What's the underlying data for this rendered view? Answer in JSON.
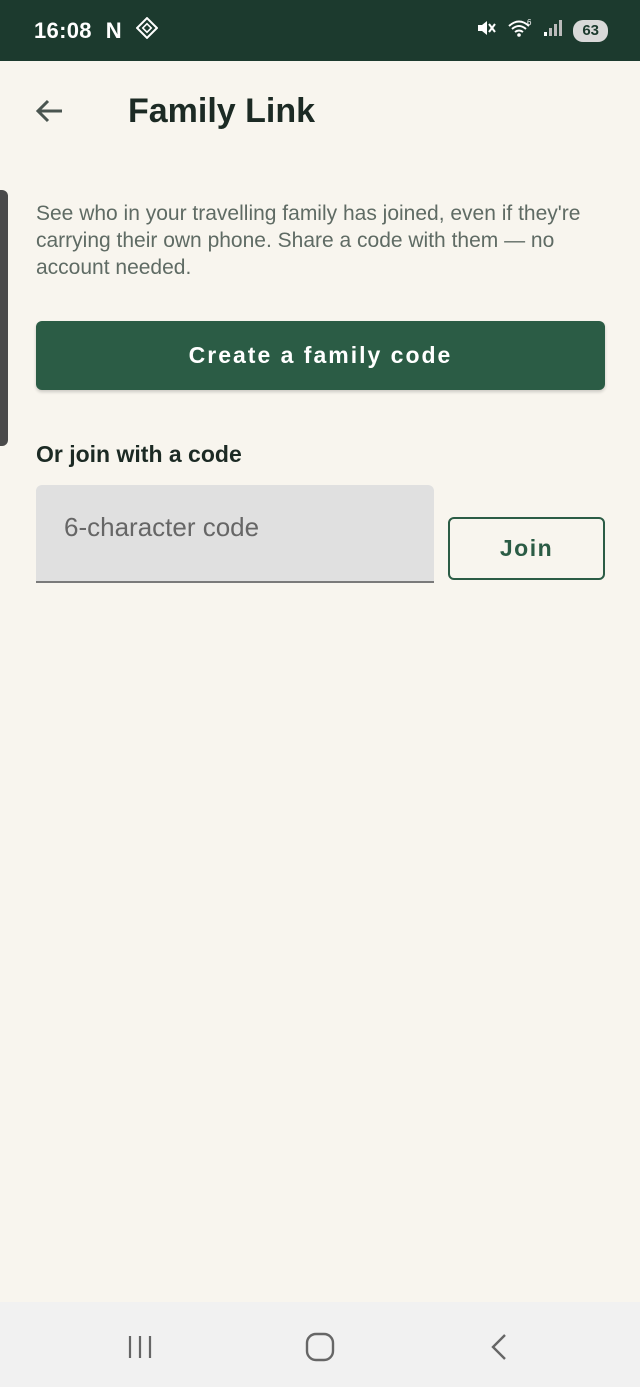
{
  "status_bar": {
    "time": "16:08",
    "notification_letter": "N",
    "battery_level": "63",
    "icons": [
      "netflix-notification-icon",
      "app-notification-icon",
      "mute-vibrate-icon",
      "wifi-icon",
      "signal-icon",
      "battery-icon"
    ],
    "background_color": "#1c3a2e"
  },
  "app_bar": {
    "title": "Family Link",
    "back_icon": "arrow-left-icon"
  },
  "main": {
    "description": "See who in your travelling family has joined, even if they're carrying their own phone. Share a code with them — no account needed.",
    "create_button_label": "Create a family code",
    "join_heading": "Or join with a code",
    "code_input": {
      "value": "",
      "placeholder": "6-character code"
    },
    "join_button_label": "Join"
  },
  "nav_bar": {
    "items": [
      "recents-icon",
      "home-icon",
      "back-icon"
    ]
  },
  "colors": {
    "accent": "#2b5c45",
    "background": "#f8f5ee",
    "title_text": "#1c2a24"
  }
}
